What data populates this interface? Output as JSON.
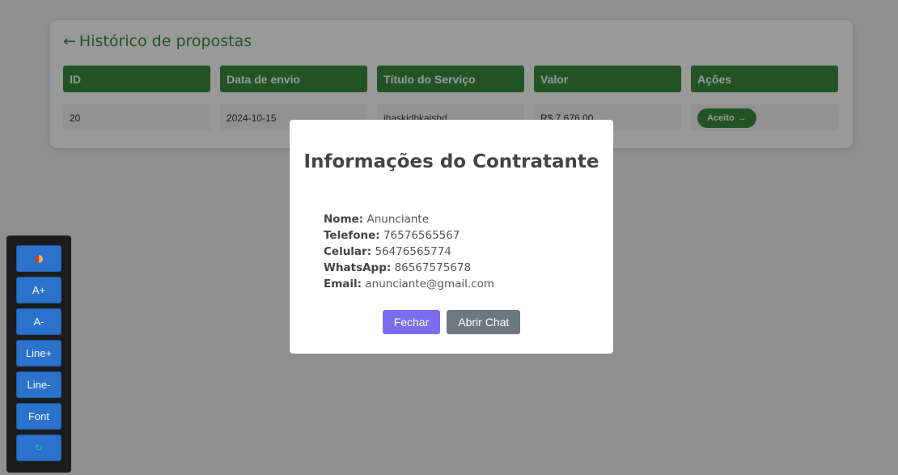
{
  "history": {
    "back_arrow": "←",
    "title": "Histórico de propostas",
    "columns": [
      "ID",
      "Data de envio",
      "Título do Serviço",
      "Valor",
      "Ações"
    ],
    "rows": [
      {
        "id": "20",
        "date": "2024-10-15",
        "service_title": "jhaskjdhkajshd",
        "value": "R$ 7.676,00",
        "action_label": "Aceito",
        "action_arrow": "→"
      }
    ]
  },
  "modal": {
    "title": "Informações do Contratante",
    "fields": [
      {
        "label": "Nome:",
        "value": "Anunciante"
      },
      {
        "label": "Telefone:",
        "value": "76576565567"
      },
      {
        "label": "Celular:",
        "value": "56476565774"
      },
      {
        "label": "WhatsApp:",
        "value": "86567575678"
      },
      {
        "label": "Email:",
        "value": "anunciante@gmail.com"
      }
    ],
    "close_label": "Fechar",
    "chat_label": "Abrir Chat"
  },
  "accessibility": {
    "buttons": [
      {
        "label": "",
        "icon": "contrast-icon"
      },
      {
        "label": "A+"
      },
      {
        "label": "A-"
      },
      {
        "label": "Line+"
      },
      {
        "label": "Line-"
      },
      {
        "label": "Font"
      },
      {
        "label": "",
        "icon": "refresh-icon"
      }
    ]
  },
  "colors": {
    "accent_green": "#3a8b3e",
    "modal_primary": "#7b6cf0",
    "modal_secondary": "#6c7880",
    "toolbar_button": "#2a72cc"
  }
}
